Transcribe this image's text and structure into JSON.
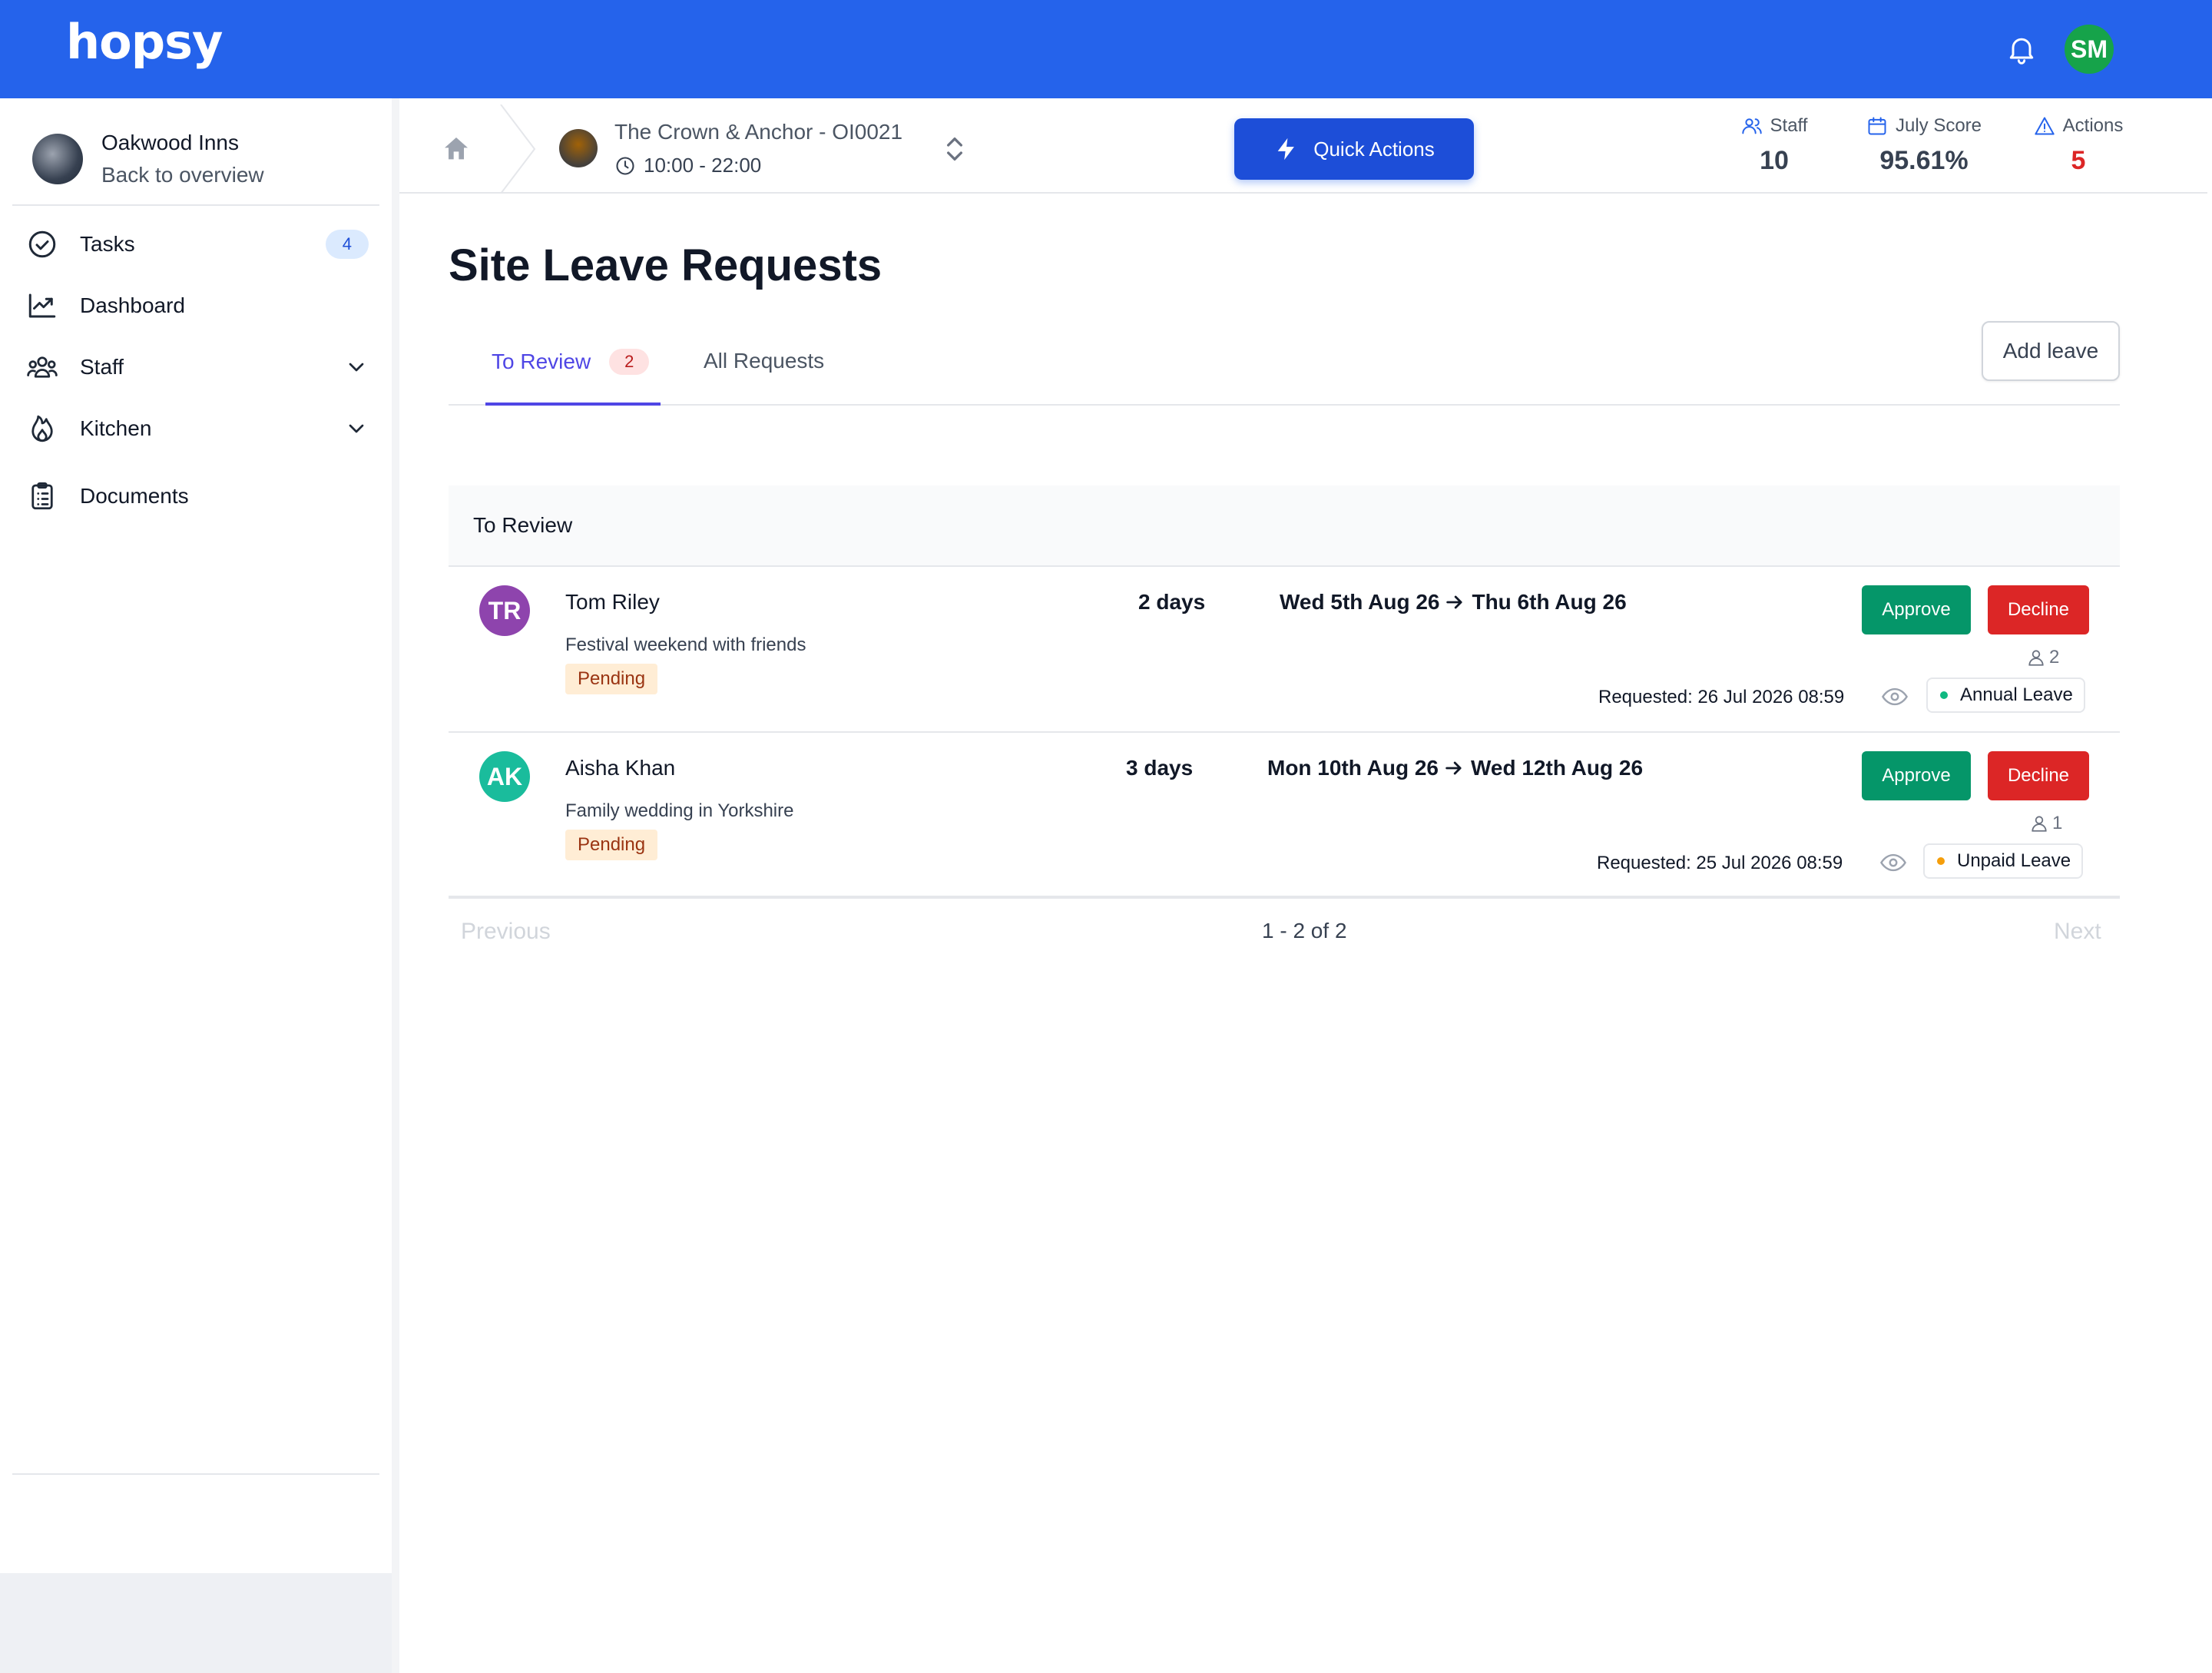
{
  "app": {
    "logo": "hopsy",
    "user_initials": "SM"
  },
  "sidebar": {
    "org_name": "Oakwood Inns",
    "back_label": "Back to overview",
    "items": [
      {
        "label": "Tasks",
        "badge": "4",
        "icon": "check-circle-icon"
      },
      {
        "label": "Dashboard",
        "icon": "chart-icon"
      },
      {
        "label": "Staff",
        "icon": "people-icon",
        "expandable": true
      },
      {
        "label": "Kitchen",
        "icon": "flame-icon",
        "expandable": true
      },
      {
        "label": "Documents",
        "icon": "clipboard-icon"
      }
    ]
  },
  "header": {
    "site_name": "The Crown & Anchor - OI0021",
    "site_hours": "10:00 - 22:00",
    "quick_actions": "Quick Actions",
    "stats": [
      {
        "label": "Staff",
        "value": "10",
        "icon": "users-icon"
      },
      {
        "label": "July Score",
        "value": "95.61%",
        "icon": "calendar-icon"
      },
      {
        "label": "Actions",
        "value": "5",
        "icon": "warning-icon",
        "color": "#dc2626"
      }
    ]
  },
  "main": {
    "title": "Site Leave Requests",
    "tabs": [
      {
        "label": "To Review",
        "count": "2",
        "active": true
      },
      {
        "label": "All Requests"
      }
    ],
    "add_leave": "Add leave",
    "section_title": "To Review",
    "requests": [
      {
        "initials": "TR",
        "avatar_color": "#8e44ad",
        "name": "Tom Riley",
        "reason": "Festival weekend with friends",
        "status": "Pending",
        "days": "2 days",
        "start": "Wed 5th Aug 26",
        "end": "Thu 6th Aug 26",
        "approve": "Approve",
        "decline": "Decline",
        "people_count": "2",
        "requested": "Requested: 26 Jul 2026 08:59",
        "leave_type": "Annual Leave",
        "leave_color": "#10b981"
      },
      {
        "initials": "AK",
        "avatar_color": "#1abc9c",
        "name": "Aisha Khan",
        "reason": "Family wedding in Yorkshire",
        "status": "Pending",
        "days": "3 days",
        "start": "Mon 10th Aug 26",
        "end": "Wed 12th Aug 26",
        "approve": "Approve",
        "decline": "Decline",
        "people_count": "1",
        "requested": "Requested: 25 Jul 2026 08:59",
        "leave_type": "Unpaid Leave",
        "leave_color": "#f59e0b"
      }
    ],
    "pagination": {
      "previous": "Previous",
      "summary": "1 - 2 of 2",
      "next": "Next"
    }
  }
}
